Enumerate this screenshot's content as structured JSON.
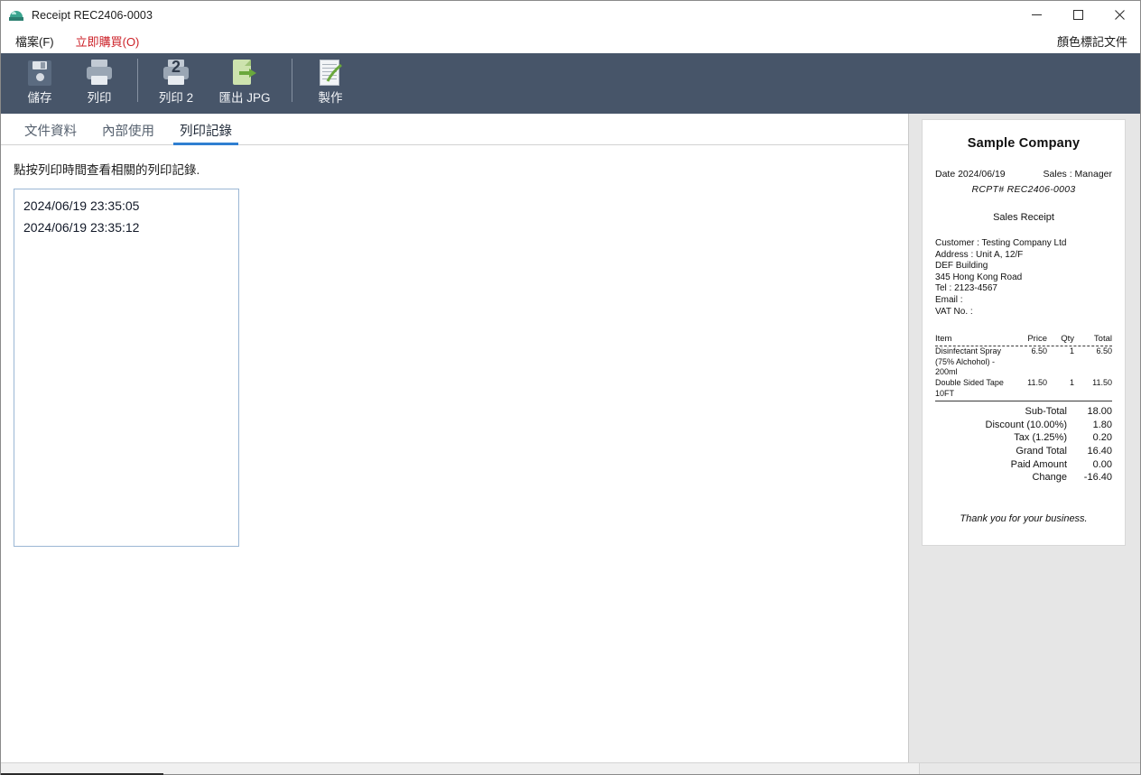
{
  "window": {
    "title": "Receipt REC2406-0003",
    "app_icon": "printer-app-icon",
    "controls": {
      "minimize": "minimize-icon",
      "maximize": "maximize-icon",
      "close": "close-icon"
    }
  },
  "menubar": {
    "items": [
      {
        "label": "檔案(F)",
        "name": "menu-file"
      },
      {
        "label": "立即購買(O)",
        "name": "menu-buy-now",
        "color": "#cc2128"
      }
    ],
    "right_label": "顏色標記文件"
  },
  "toolbar": {
    "background": "#475569",
    "buttons": [
      {
        "label": "儲存",
        "icon": "save-icon",
        "name": "save-button"
      },
      {
        "label": "列印",
        "icon": "print-icon",
        "name": "print-button"
      },
      {
        "label": "列印 2",
        "icon": "print-2-icon",
        "name": "print-2-button",
        "badge": "2"
      },
      {
        "label": "匯出 JPG",
        "icon": "export-jpg-icon",
        "name": "export-jpg-button"
      },
      {
        "label": "製作",
        "icon": "compose-icon",
        "name": "compose-button"
      }
    ]
  },
  "tabs": [
    {
      "label": "文件資料",
      "name": "tab-document-data",
      "active": false
    },
    {
      "label": "內部使用",
      "name": "tab-internal-use",
      "active": false
    },
    {
      "label": "列印記錄",
      "name": "tab-print-log",
      "active": true
    }
  ],
  "main": {
    "hint": "點按列印時間查看相關的列印記錄.",
    "print_log": [
      "2024/06/19 23:35:05",
      "2024/06/19 23:35:12"
    ]
  },
  "receipt": {
    "company": "Sample Company",
    "date_label": "Date 2024/06/19",
    "sales_label": "Sales : Manager",
    "rcpt_no": "RCPT# REC2406-0003",
    "doc_title": "Sales Receipt",
    "info_lines": [
      "Customer : Testing Company Ltd",
      "Address : Unit A, 12/F",
      "DEF Building",
      "345 Hong Kong Road",
      "Tel : 2123-4567",
      "Email :",
      "VAT No. :"
    ],
    "columns": {
      "item": "Item",
      "price": "Price",
      "qty": "Qty",
      "total": "Total"
    },
    "items": [
      {
        "name": "Disinfectant Spray (75% Alchohol) - 200ml",
        "price": "6.50",
        "qty": "1",
        "total": "6.50"
      },
      {
        "name": "Double Sided Tape 10FT",
        "price": "11.50",
        "qty": "1",
        "total": "11.50"
      }
    ],
    "totals": [
      {
        "label": "Sub-Total",
        "value": "18.00"
      },
      {
        "label": "Discount (10.00%)",
        "value": "1.80"
      },
      {
        "label": "Tax (1.25%)",
        "value": "0.20"
      },
      {
        "label": "Grand Total",
        "value": "16.40"
      },
      {
        "label": "Paid Amount",
        "value": "0.00"
      },
      {
        "label": "Change",
        "value": "-16.40"
      }
    ],
    "footer": "Thank you for your business."
  }
}
